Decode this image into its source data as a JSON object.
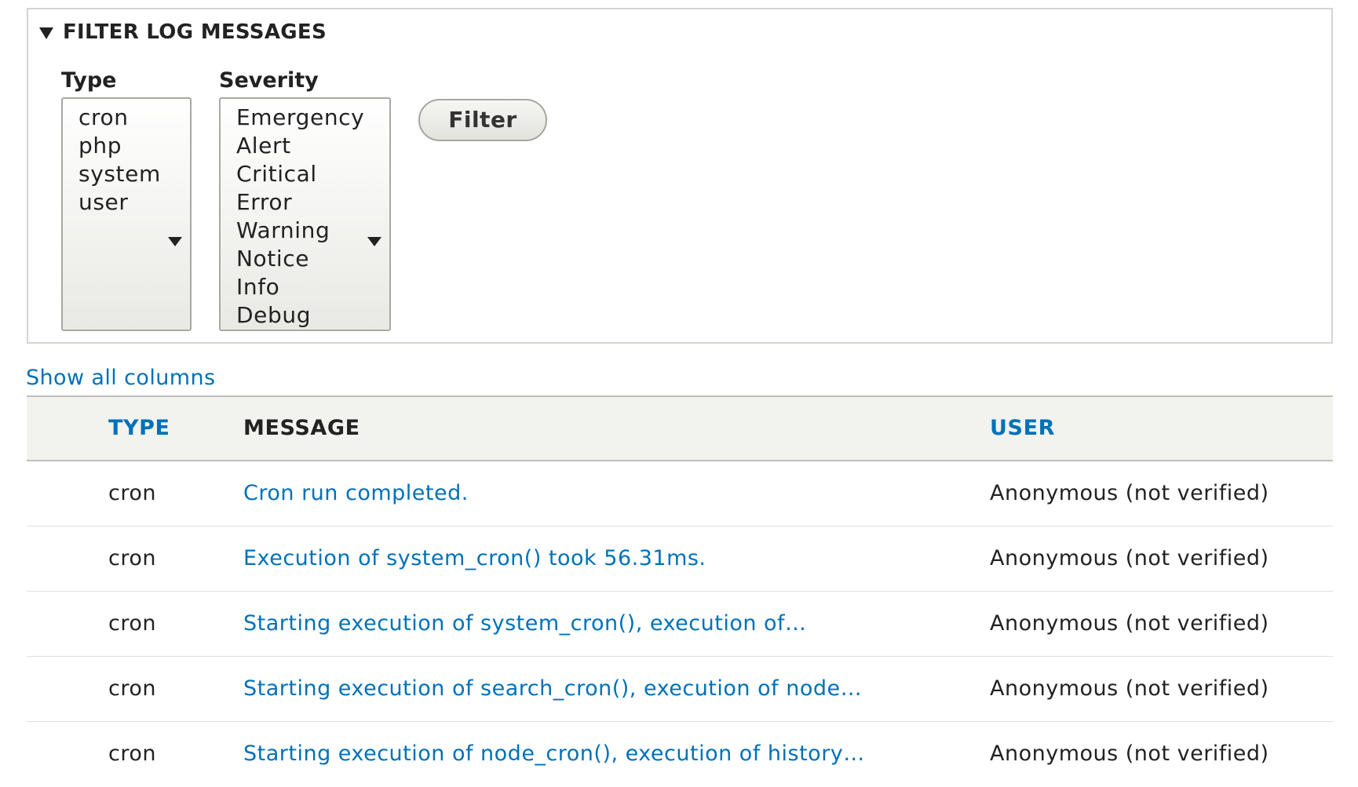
{
  "filter": {
    "legend": "FILTER LOG MESSAGES",
    "type_label": "Type",
    "type_options": [
      "cron",
      "php",
      "system",
      "user"
    ],
    "severity_label": "Severity",
    "severity_options": [
      "Emergency",
      "Alert",
      "Critical",
      "Error",
      "Warning",
      "Notice",
      "Info",
      "Debug"
    ],
    "filter_button": "Filter"
  },
  "show_all_columns": "Show all columns",
  "table": {
    "headers": {
      "type": "TYPE",
      "message": "MESSAGE",
      "user": "USER"
    },
    "rows": [
      {
        "type": "cron",
        "message": "Cron run completed.",
        "user": "Anonymous (not verified)"
      },
      {
        "type": "cron",
        "message": "Execution of system_cron() took 56.31ms.",
        "user": "Anonymous (not verified)"
      },
      {
        "type": "cron",
        "message": "Starting execution of system_cron(), execution of…",
        "user": "Anonymous (not verified)"
      },
      {
        "type": "cron",
        "message": "Starting execution of search_cron(), execution of node…",
        "user": "Anonymous (not verified)"
      },
      {
        "type": "cron",
        "message": "Starting execution of node_cron(), execution of history…",
        "user": "Anonymous (not verified)"
      }
    ]
  },
  "colors": {
    "link": "#0071b8",
    "text": "#222222",
    "header_bg": "#f2f2ef",
    "border": "#d4d4d0"
  }
}
